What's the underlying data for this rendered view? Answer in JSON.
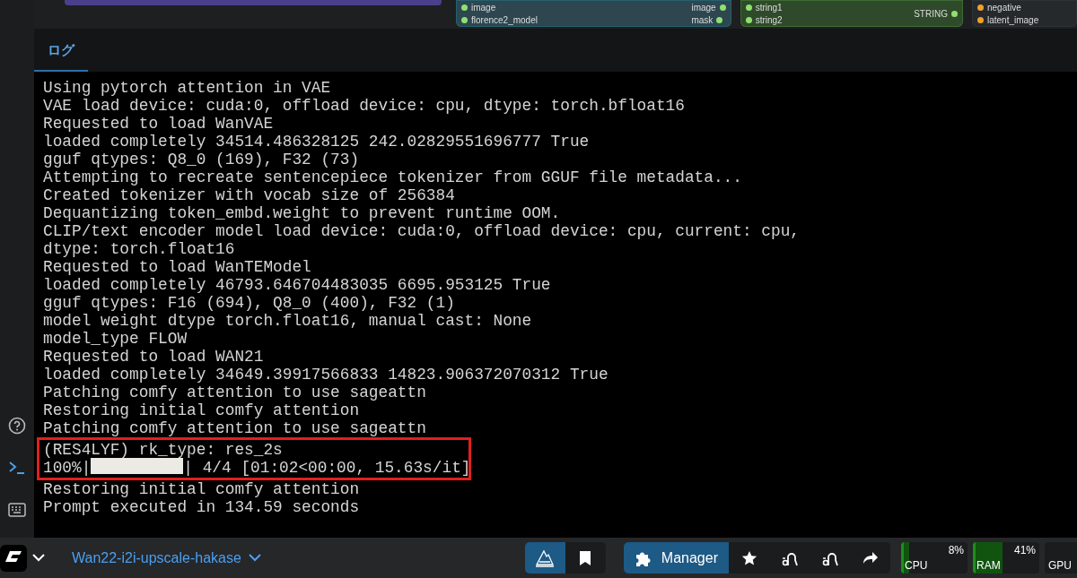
{
  "graph": {
    "nodes": [
      {
        "kind": "plain"
      },
      {
        "kind": "teal",
        "inputs": [
          "image",
          "florence2_model"
        ],
        "outputs": [
          "image",
          "mask"
        ]
      },
      {
        "kind": "green",
        "inputs": [
          "string1",
          "string2"
        ],
        "outputs": [
          "STRING"
        ]
      },
      {
        "kind": "dark",
        "inputs": [
          "negative",
          "latent_image"
        ]
      }
    ]
  },
  "sidebar": {
    "items": [
      {
        "selected": false
      },
      {
        "selected": true
      },
      {
        "selected": false
      }
    ]
  },
  "panel": {
    "tabs": [
      {
        "label": "ログ",
        "selected": true
      }
    ],
    "lines": [
      {
        "kind": "text",
        "text": "Using pytorch attention in VAE",
        "highlighted": false
      },
      {
        "kind": "text",
        "text": "VAE load device: cuda:0, offload device: cpu, dtype: torch.bfloat16",
        "highlighted": false
      },
      {
        "kind": "text",
        "text": "Requested to load WanVAE",
        "highlighted": false
      },
      {
        "kind": "text",
        "text": "loaded completely 34514.486328125 242.02829551696777 True",
        "highlighted": false
      },
      {
        "kind": "text",
        "text": "gguf qtypes: Q8_0 (169), F32 (73)",
        "highlighted": false
      },
      {
        "kind": "text",
        "text": "Attempting to recreate sentencepiece tokenizer from GGUF file metadata...",
        "highlighted": false
      },
      {
        "kind": "text",
        "text": "Created tokenizer with vocab size of 256384",
        "highlighted": false
      },
      {
        "kind": "text",
        "text": "Dequantizing token_embd.weight to prevent runtime OOM.",
        "highlighted": false
      },
      {
        "kind": "text",
        "text": "CLIP/text encoder model load device: cuda:0, offload device: cpu, current: cpu,",
        "highlighted": false
      },
      {
        "kind": "text",
        "text": "dtype: torch.float16",
        "highlighted": false
      },
      {
        "kind": "text",
        "text": "Requested to load WanTEModel",
        "highlighted": false
      },
      {
        "kind": "text",
        "text": "loaded completely 46793.646704483035 6695.953125 True",
        "highlighted": false
      },
      {
        "kind": "text",
        "text": "gguf qtypes: F16 (694), Q8_0 (400), F32 (1)",
        "highlighted": false
      },
      {
        "kind": "text",
        "text": "model weight dtype torch.float16, manual cast: None",
        "highlighted": false
      },
      {
        "kind": "text",
        "text": "model_type FLOW",
        "highlighted": false
      },
      {
        "kind": "text",
        "text": "Requested to load WAN21",
        "highlighted": false
      },
      {
        "kind": "text",
        "text": "loaded completely 34649.39917566833 14823.906372070312 True",
        "highlighted": false
      },
      {
        "kind": "text",
        "text": "Patching comfy attention to use sageattn",
        "highlighted": false
      },
      {
        "kind": "text",
        "text": "Restoring initial comfy attention",
        "highlighted": false
      },
      {
        "kind": "text",
        "text": "Patching comfy attention to use sageattn",
        "highlighted": false
      },
      {
        "kind": "text",
        "text": "(RES4LYF) rk_type: res_2s",
        "highlighted": true
      },
      {
        "kind": "progress",
        "prefix": "100%|",
        "level": 1,
        "suffix": "| 4/4 [01:02<00:00, 15.63s/it]",
        "highlighted": true
      },
      {
        "kind": "text",
        "text": "Restoring initial comfy attention",
        "highlighted": false
      },
      {
        "kind": "text",
        "text": "Prompt executed in 134.59 seconds",
        "highlighted": false
      }
    ]
  },
  "bottom_bar": {
    "workflow": "Wan22-i2i-upscale-hakase",
    "view_buttons": [
      {
        "selected": true
      },
      {
        "selected": false
      }
    ],
    "tools": [
      {
        "label": "Manager",
        "selected": true
      },
      {
        "selected": false
      },
      {
        "selected": false
      },
      {
        "selected": false
      },
      {
        "selected": false
      }
    ],
    "monitors": [
      {
        "label": "CPU",
        "reading": "8%",
        "level": 0.08
      },
      {
        "label": "RAM",
        "reading": "41%",
        "level": 0.41
      },
      {
        "label": "GPU"
      }
    ]
  }
}
